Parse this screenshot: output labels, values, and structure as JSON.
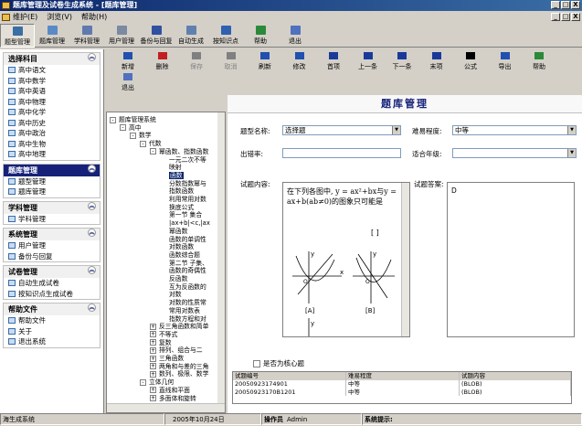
{
  "window": {
    "title": "题库管理及试卷生成系统 - [题库管理]",
    "btns": [
      "_",
      "□",
      "X"
    ],
    "inner_btns": [
      "_",
      "□",
      "X"
    ]
  },
  "menu": [
    "维护(E)",
    "浏览(V)",
    "帮助(H)"
  ],
  "toolbar1": [
    {
      "label": "题型管理",
      "icon": "grid-icon",
      "color": "#3a6ea5"
    },
    {
      "label": "题库管理",
      "icon": "db-icon",
      "color": "#5a8ac6"
    },
    {
      "label": "学科管理",
      "icon": "form-icon",
      "color": "#607ab0"
    },
    {
      "label": "用户管理",
      "icon": "users-icon",
      "color": "#7a8aa0"
    },
    {
      "label": "备份与回复",
      "icon": "save-icon",
      "color": "#3050a0"
    },
    {
      "label": "自动生成",
      "icon": "doc-icon",
      "color": "#6080b0"
    },
    {
      "label": "按知识点",
      "icon": "table-icon",
      "color": "#3060b0"
    },
    {
      "label": "帮助",
      "icon": "book-icon",
      "color": "#2a8a3a"
    },
    {
      "label": "退出",
      "icon": "exit-icon",
      "color": "#5070c0"
    }
  ],
  "sidebar": {
    "groups": [
      {
        "title": "选择科目",
        "dark": false,
        "items": [
          "高中语文",
          "高中数学",
          "高中英语",
          "高中物理",
          "高中化学",
          "高中历史",
          "高中政治",
          "高中生物",
          "高中地理"
        ]
      },
      {
        "title": "题库管理",
        "dark": true,
        "items": [
          "题型管理",
          "题库管理"
        ]
      },
      {
        "title": "学科管理",
        "dark": false,
        "items": [
          "学科管理"
        ]
      },
      {
        "title": "系统管理",
        "dark": false,
        "items": [
          "用户管理",
          "备份与回复"
        ]
      },
      {
        "title": "试卷管理",
        "dark": false,
        "items": [
          "自动生成试卷",
          "按知识点生成试卷"
        ]
      },
      {
        "title": "帮助文件",
        "dark": false,
        "items": [
          "帮助文件",
          "关于",
          "退出系统"
        ]
      }
    ],
    "collapse": "︽"
  },
  "toolbar2": [
    {
      "label": "新增",
      "enabled": true
    },
    {
      "label": "删除",
      "enabled": true
    },
    {
      "label": "保存",
      "enabled": false
    },
    {
      "label": "取消",
      "enabled": false
    },
    {
      "label": "刷新",
      "enabled": true
    },
    {
      "label": "修改",
      "enabled": true
    },
    {
      "label": "首项",
      "enabled": true
    },
    {
      "label": "上一条",
      "enabled": true
    },
    {
      "label": "下一条",
      "enabled": true
    },
    {
      "label": "末项",
      "enabled": true
    },
    {
      "label": "公式",
      "enabled": true
    },
    {
      "label": "导出",
      "enabled": true
    },
    {
      "label": "帮助",
      "enabled": true
    },
    {
      "label": "退出",
      "enabled": true
    }
  ],
  "tree": [
    {
      "t": "题库管理系统",
      "lvl": 0,
      "pm": "-"
    },
    {
      "t": "高中",
      "lvl": 1,
      "pm": "-"
    },
    {
      "t": "数学",
      "lvl": 2,
      "pm": "-"
    },
    {
      "t": "代数",
      "lvl": 3,
      "pm": "-"
    },
    {
      "t": "幂函数、指数函数",
      "lvl": 4,
      "pm": "-"
    },
    {
      "t": "一元二次不等",
      "lvl": 5
    },
    {
      "t": "映射",
      "lvl": 5
    },
    {
      "t": "函数",
      "lvl": 5,
      "sel": true
    },
    {
      "t": "分数指数幂与",
      "lvl": 5
    },
    {
      "t": "指数函数",
      "lvl": 5
    },
    {
      "t": "利用常用对数",
      "lvl": 5
    },
    {
      "t": "换底公式",
      "lvl": 5
    },
    {
      "t": "第一节 集合",
      "lvl": 5
    },
    {
      "t": "|ax+b|<c,|ax",
      "lvl": 5
    },
    {
      "t": "幂函数",
      "lvl": 5
    },
    {
      "t": "函数的单调性",
      "lvl": 5
    },
    {
      "t": "对数函数",
      "lvl": 5
    },
    {
      "t": "函数综合题",
      "lvl": 5
    },
    {
      "t": "第二节 子集、",
      "lvl": 5
    },
    {
      "t": "函数的奇偶性",
      "lvl": 5
    },
    {
      "t": "反函数",
      "lvl": 5
    },
    {
      "t": "互为反函数的",
      "lvl": 5
    },
    {
      "t": "对数",
      "lvl": 5
    },
    {
      "t": "对数的性质常",
      "lvl": 5
    },
    {
      "t": "常用对数表",
      "lvl": 5
    },
    {
      "t": "指数方程和对",
      "lvl": 5
    },
    {
      "t": "反三角函数和简单",
      "lvl": 4,
      "pm": "+"
    },
    {
      "t": "不等式",
      "lvl": 4,
      "pm": "+"
    },
    {
      "t": "复数",
      "lvl": 4,
      "pm": "+"
    },
    {
      "t": "排列、组合与二",
      "lvl": 4,
      "pm": "+"
    },
    {
      "t": "三角函数",
      "lvl": 4,
      "pm": "+"
    },
    {
      "t": "两角和与差的三角",
      "lvl": 4,
      "pm": "+"
    },
    {
      "t": "数列、极限、数学",
      "lvl": 4,
      "pm": "+"
    },
    {
      "t": "立体几何",
      "lvl": 3,
      "pm": "-"
    },
    {
      "t": "直线和平面",
      "lvl": 4,
      "pm": "+"
    },
    {
      "t": "多面体和旋转",
      "lvl": 4,
      "pm": "+"
    }
  ],
  "content": {
    "title": "题库管理",
    "type_label": "题型名称:",
    "type_value": "选择题",
    "diff_label": "难易程度:",
    "diff_value": "中等",
    "author_label": "出错率:",
    "author_value": "",
    "grade_label": "适合年级:",
    "grade_value": "",
    "q_label": "试题内容:",
    "a_label": "试题答案:",
    "question": "在下列各图中, y = ax²+bx与y = ax+b(ab≠0)的图象只可能是",
    "bracket": "[ ]",
    "answer": "D",
    "graph_labels": [
      "[A]",
      "[B]"
    ],
    "axis": {
      "x": "x",
      "y": "y",
      "o": "O"
    },
    "core_label": "是否为核心题",
    "grid": {
      "headers": [
        "试题编号",
        "难易程度",
        "试题内容"
      ],
      "rows": [
        [
          "20050923174901",
          "中等",
          "(BLOB)"
        ],
        [
          "20050923170B1201",
          "中等",
          "(BLOB)"
        ]
      ]
    }
  },
  "status": {
    "app": "海生成系统",
    "date": "2005年10月24日",
    "user_label": "操作员",
    "user": "Admin",
    "hint_label": "系统提示:"
  }
}
